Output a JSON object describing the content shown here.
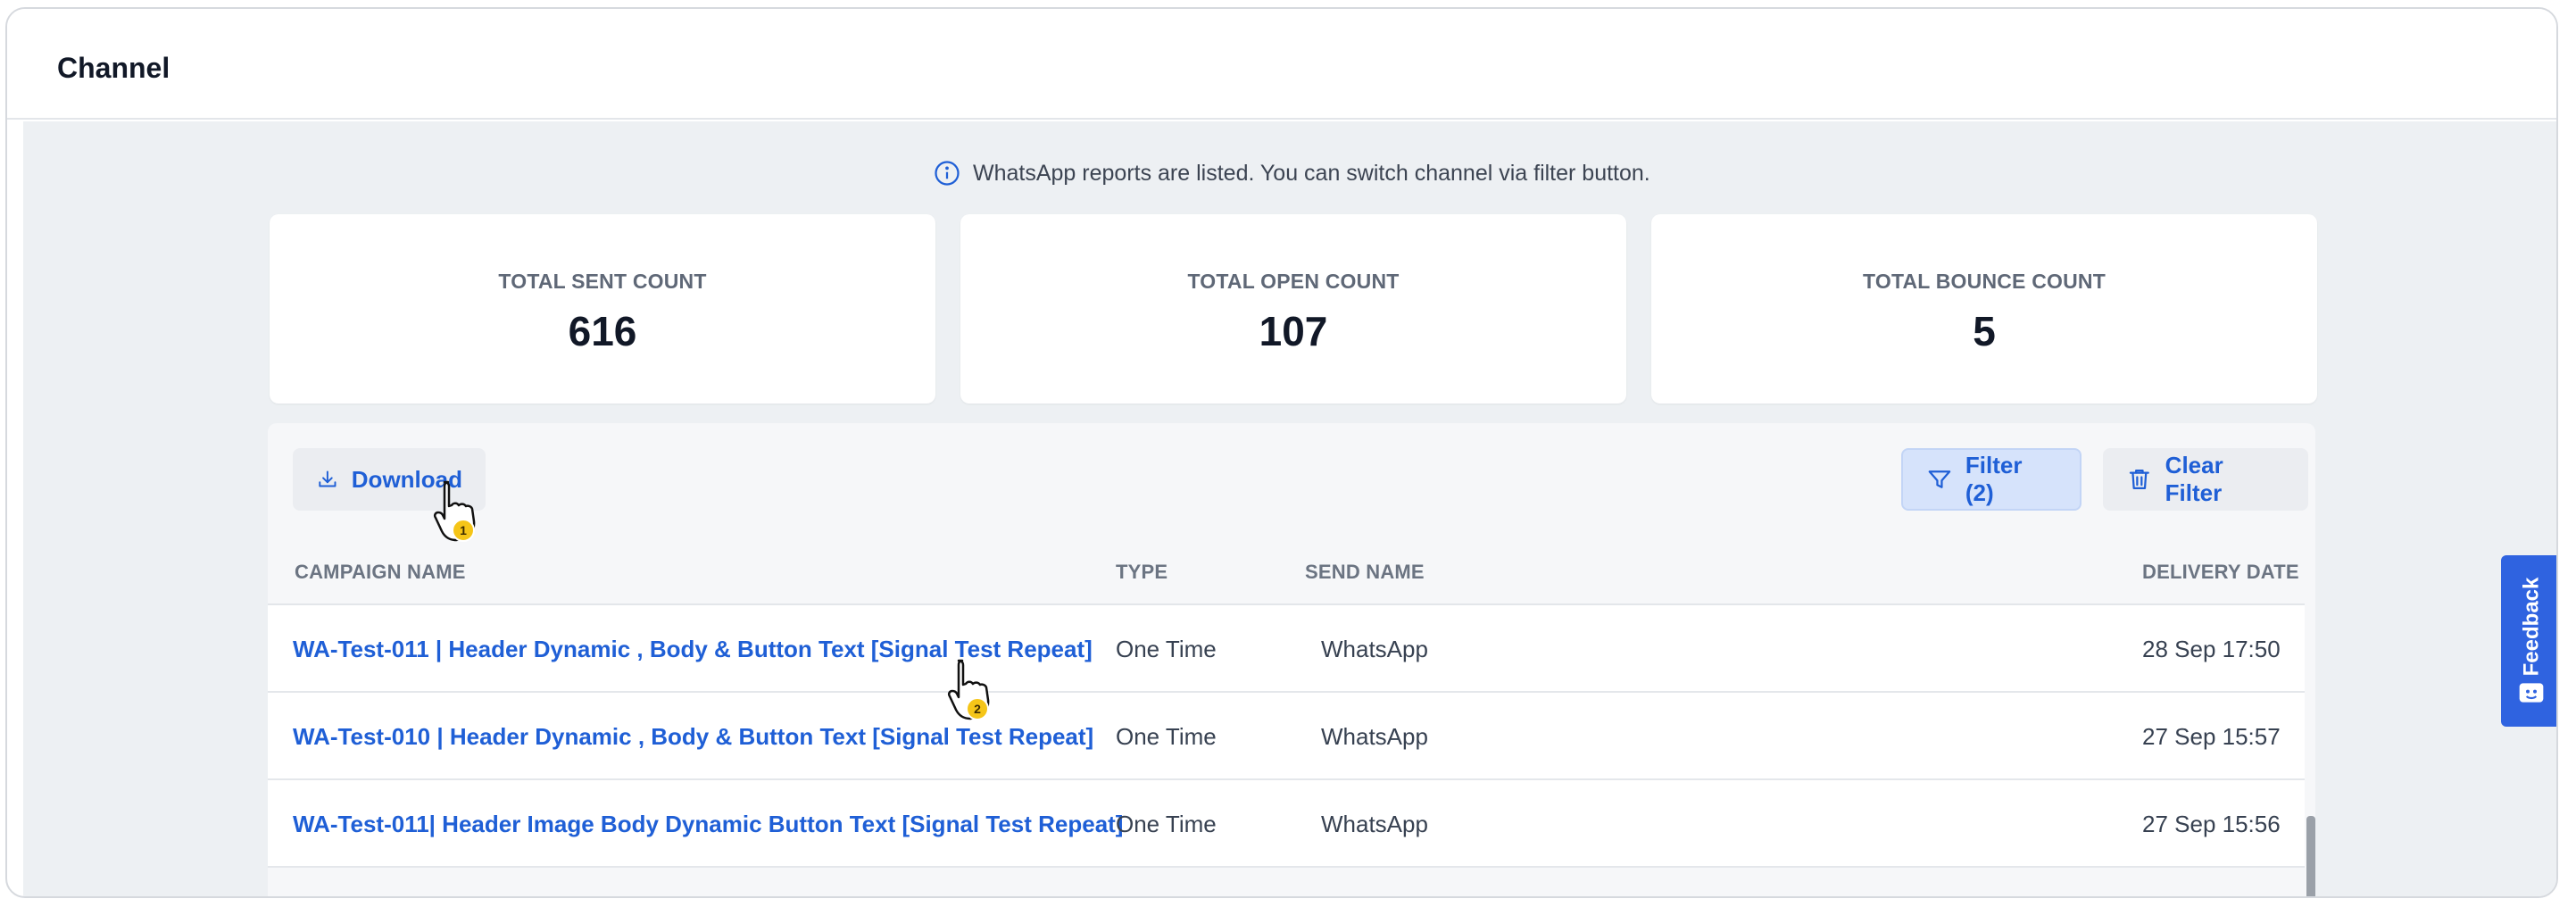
{
  "header": {
    "title": "Channel"
  },
  "info_banner": {
    "text": "WhatsApp reports are listed. You can switch channel via filter button.",
    "icon": "info-icon"
  },
  "stats": [
    {
      "label": "TOTAL SENT COUNT",
      "value": "616"
    },
    {
      "label": "TOTAL OPEN COUNT",
      "value": "107"
    },
    {
      "label": "TOTAL BOUNCE COUNT",
      "value": "5"
    }
  ],
  "toolbar": {
    "download_label": "Download",
    "filter_label": "Filter (2)",
    "clear_filter_label": "Clear Filter"
  },
  "table": {
    "columns": [
      "CAMPAIGN NAME",
      "TYPE",
      "SEND NAME",
      "DELIVERY DATE"
    ],
    "rows": [
      {
        "campaign": "WA-Test-011 | Header Dynamic , Body & Button Text [Signal Test Repeat]",
        "type": "One Time",
        "send_name": "WhatsApp",
        "date": "28 Sep 17:50"
      },
      {
        "campaign": "WA-Test-010 | Header Dynamic , Body & Button Text [Signal Test Repeat]",
        "type": "One Time",
        "send_name": "WhatsApp",
        "date": "27 Sep 15:57"
      },
      {
        "campaign": "WA-Test-011| Header Image Body Dynamic Button Text [Signal Test Repeat]",
        "type": "One Time",
        "send_name": "WhatsApp",
        "date": "27 Sep 15:56"
      }
    ]
  },
  "feedback": {
    "label": "Feedback"
  },
  "cursors": [
    {
      "step": "1"
    },
    {
      "step": "2"
    }
  ],
  "colors": {
    "accent": "#1f5fd6",
    "feedback_bg": "#2f63e0",
    "badge": "#f5c518",
    "content_bg": "#edf0f3"
  }
}
